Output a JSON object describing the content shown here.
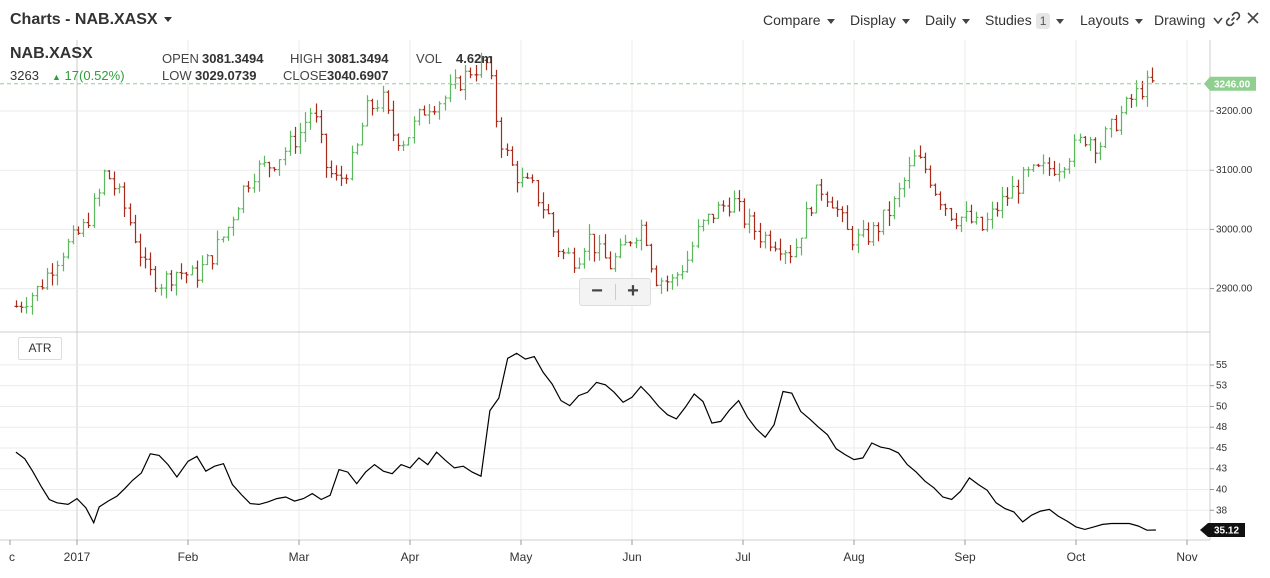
{
  "header": {
    "title": "Charts - NAB.XASX",
    "menus": [
      "Compare",
      "Display",
      "Daily",
      "Studies",
      "Layouts",
      "Drawing"
    ],
    "studies_count": "1"
  },
  "quote": {
    "symbol": "NAB.XASX",
    "last": "3263",
    "change": "17(0.52%)",
    "open_label": "OPEN",
    "open": "3081.3494",
    "high_label": "HIGH",
    "high": "3081.3494",
    "vol_label": "VOL",
    "vol": "4.62m",
    "low_label": "LOW",
    "low": "3029.0739",
    "close_label": "CLOSE",
    "close": "3040.6907"
  },
  "zoom": {
    "minus": "−",
    "plus": "+"
  },
  "colors": {
    "up": "#5cb85c",
    "down": "#a82a1a",
    "last_price_bg": "#8fcf8f",
    "atr_line": "#000000",
    "grid": "#ebebeb"
  },
  "chart_data": [
    {
      "type": "ohlc",
      "series_name": "NAB.XASX",
      "ylim": [
        2830,
        3320
      ],
      "y_ticks": [
        "3200.00",
        "3100.00",
        "3000.00",
        "2900.00"
      ],
      "y_tick_values": [
        3200,
        3100,
        3000,
        2900
      ],
      "last_price_label": "3246.00",
      "last_price": 3246,
      "x_range_months": [
        -0.5,
        10.1
      ],
      "x_tick_labels": [
        "c",
        "2017",
        "Feb",
        "Mar",
        "Apr",
        "May",
        "Jun",
        "Jul",
        "Aug",
        "Sep",
        "Oct",
        "Nov"
      ],
      "x_tick_positions": [
        -0.5,
        0,
        1,
        2,
        3,
        4,
        5,
        6,
        7,
        8,
        9,
        10
      ],
      "close_trace": [
        [
          -0.55,
          2870
        ],
        [
          -0.35,
          2900
        ],
        [
          -0.15,
          2960
        ],
        [
          0.05,
          3000
        ],
        [
          0.2,
          3060
        ],
        [
          0.25,
          3100
        ],
        [
          0.4,
          3050
        ],
        [
          0.5,
          3000
        ],
        [
          0.62,
          2930
        ],
        [
          0.75,
          2910
        ],
        [
          0.9,
          2930
        ],
        [
          1.05,
          2920
        ],
        [
          1.2,
          2950
        ],
        [
          1.35,
          3000
        ],
        [
          1.5,
          3070
        ],
        [
          1.6,
          3100
        ],
        [
          1.75,
          3110
        ],
        [
          1.9,
          3140
        ],
        [
          2.0,
          3160
        ],
        [
          2.1,
          3200
        ],
        [
          2.15,
          3180
        ],
        [
          2.25,
          3100
        ],
        [
          2.35,
          3080
        ],
        [
          2.5,
          3120
        ],
        [
          2.6,
          3200
        ],
        [
          2.75,
          3220
        ],
        [
          2.85,
          3160
        ],
        [
          2.95,
          3150
        ],
        [
          3.05,
          3180
        ],
        [
          3.15,
          3210
        ],
        [
          3.3,
          3220
        ],
        [
          3.45,
          3250
        ],
        [
          3.55,
          3270
        ],
        [
          3.7,
          3280
        ],
        [
          3.8,
          3160
        ],
        [
          3.9,
          3110
        ],
        [
          4.0,
          3080
        ],
        [
          4.1,
          3070
        ],
        [
          4.25,
          3020
        ],
        [
          4.35,
          2960
        ],
        [
          4.5,
          2950
        ],
        [
          4.6,
          2990
        ],
        [
          4.7,
          2960
        ],
        [
          4.8,
          2940
        ],
        [
          4.9,
          2960
        ],
        [
          5.0,
          2990
        ],
        [
          5.1,
          3010
        ],
        [
          5.2,
          2920
        ],
        [
          5.35,
          2910
        ],
        [
          5.5,
          2950
        ],
        [
          5.6,
          3000
        ],
        [
          5.75,
          3030
        ],
        [
          5.9,
          3050
        ],
        [
          6.0,
          3020
        ],
        [
          6.15,
          2990
        ],
        [
          6.3,
          2980
        ],
        [
          6.45,
          2960
        ],
        [
          6.6,
          3040
        ],
        [
          6.7,
          3070
        ],
        [
          6.8,
          3050
        ],
        [
          6.95,
          2990
        ],
        [
          7.05,
          2980
        ],
        [
          7.2,
          3000
        ],
        [
          7.35,
          3040
        ],
        [
          7.45,
          3080
        ],
        [
          7.55,
          3120
        ],
        [
          7.65,
          3100
        ],
        [
          7.75,
          3060
        ],
        [
          7.9,
          3020
        ],
        [
          8.0,
          3020
        ],
        [
          8.15,
          3000
        ],
        [
          8.3,
          3040
        ],
        [
          8.4,
          3060
        ],
        [
          8.55,
          3090
        ],
        [
          8.7,
          3100
        ],
        [
          8.85,
          3110
        ],
        [
          9.0,
          3140
        ],
        [
          9.1,
          3160
        ],
        [
          9.2,
          3140
        ],
        [
          9.35,
          3180
        ],
        [
          9.5,
          3220
        ],
        [
          9.6,
          3240
        ],
        [
          9.7,
          3246
        ]
      ]
    },
    {
      "type": "line",
      "study": "ATR",
      "ylim": [
        34.4,
        58.0
      ],
      "y_ticks": [
        "55",
        "53",
        "50",
        "48",
        "45",
        "43",
        "40",
        "38"
      ],
      "y_tick_values": [
        55,
        52.5,
        50,
        47.5,
        45,
        42.5,
        40,
        37.5
      ],
      "last_value_label": "35.12",
      "x": [
        -0.55,
        -0.47,
        -0.4,
        -0.32,
        -0.25,
        -0.18,
        -0.08,
        0.0,
        0.08,
        0.15,
        0.2,
        0.28,
        0.36,
        0.43,
        0.5,
        0.58,
        0.66,
        0.74,
        0.82,
        0.9,
        1.0,
        1.08,
        1.16,
        1.24,
        1.32,
        1.4,
        1.48,
        1.56,
        1.64,
        1.72,
        1.8,
        1.88,
        1.96,
        2.04,
        2.12,
        2.2,
        2.28,
        2.36,
        2.44,
        2.52,
        2.6,
        2.68,
        2.76,
        2.84,
        2.92,
        3.0,
        3.08,
        3.16,
        3.24,
        3.32,
        3.4,
        3.48,
        3.56,
        3.64,
        3.72,
        3.8,
        3.88,
        3.96,
        4.04,
        4.12,
        4.2,
        4.28,
        4.36,
        4.44,
        4.52,
        4.6,
        4.68,
        4.76,
        4.84,
        4.92,
        5.0,
        5.08,
        5.16,
        5.24,
        5.32,
        5.4,
        5.48,
        5.56,
        5.64,
        5.72,
        5.8,
        5.88,
        5.96,
        6.04,
        6.12,
        6.2,
        6.28,
        6.36,
        6.44,
        6.52,
        6.6,
        6.68,
        6.76,
        6.84,
        6.92,
        7.0,
        7.08,
        7.16,
        7.24,
        7.32,
        7.4,
        7.48,
        7.56,
        7.64,
        7.72,
        7.8,
        7.88,
        7.96,
        8.04,
        8.12,
        8.2,
        8.28,
        8.36,
        8.44,
        8.52,
        8.6,
        8.68,
        8.76,
        8.84,
        8.92,
        9.0,
        9.08,
        9.16,
        9.24,
        9.32,
        9.4,
        9.48,
        9.56,
        9.64,
        9.72
      ],
      "values": [
        44.5,
        43.7,
        42.2,
        40.3,
        38.8,
        38.4,
        38.2,
        38.9,
        37.8,
        36.0,
        37.9,
        38.6,
        39.2,
        40.1,
        41.1,
        42.0,
        44.3,
        44.1,
        43.0,
        41.5,
        43.4,
        44.0,
        42.2,
        42.8,
        43.1,
        40.6,
        39.4,
        38.3,
        38.2,
        38.5,
        38.9,
        39.1,
        38.6,
        38.9,
        39.5,
        38.8,
        39.3,
        42.4,
        42.1,
        40.7,
        42.1,
        43.0,
        42.2,
        41.9,
        43.0,
        42.6,
        43.8,
        43.0,
        44.5,
        43.5,
        42.6,
        42.8,
        42.1,
        41.6,
        49.5,
        51.0,
        55.8,
        56.4,
        55.7,
        56.0,
        54.1,
        52.7,
        50.7,
        50.1,
        51.3,
        51.7,
        52.9,
        52.6,
        51.7,
        50.5,
        51.1,
        52.4,
        51.3,
        50.0,
        49.0,
        48.5,
        49.9,
        51.5,
        50.6,
        48.0,
        48.2,
        49.6,
        50.7,
        48.7,
        47.3,
        46.3,
        47.8,
        51.8,
        51.6,
        49.4,
        48.5,
        47.5,
        46.6,
        44.9,
        44.2,
        43.6,
        43.8,
        45.6,
        45.1,
        44.9,
        44.4,
        43.0,
        42.1,
        41.0,
        40.2,
        39.1,
        38.8,
        39.8,
        41.4,
        40.6,
        39.9,
        38.4,
        37.7,
        37.3,
        36.1,
        36.9,
        37.4,
        37.6,
        36.8,
        36.2,
        35.5,
        35.2,
        35.5,
        35.8,
        35.9,
        35.9,
        35.9,
        35.6,
        35.1,
        35.12
      ]
    }
  ]
}
